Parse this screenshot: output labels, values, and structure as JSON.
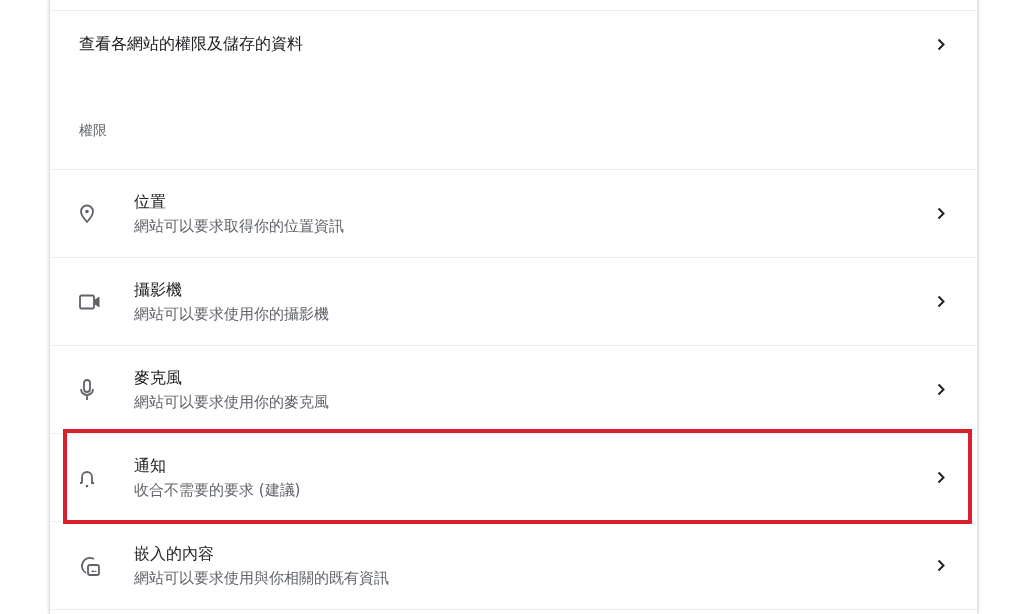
{
  "site_settings_link": {
    "label": "查看各網站的權限及儲存的資料"
  },
  "permissions": {
    "heading": "權限",
    "items": [
      {
        "kind": "location",
        "title": "位置",
        "subtitle": "網站可以要求取得你的位置資訊",
        "highlighted": false
      },
      {
        "kind": "camera",
        "title": "攝影機",
        "subtitle": "網站可以要求使用你的攝影機",
        "highlighted": false
      },
      {
        "kind": "microphone",
        "title": "麥克風",
        "subtitle": "網站可以要求使用你的麥克風",
        "highlighted": false
      },
      {
        "kind": "notifications",
        "title": "通知",
        "subtitle": "收合不需要的要求 (建議)",
        "highlighted": true
      },
      {
        "kind": "embedded",
        "title": "嵌入的內容",
        "subtitle": "網站可以要求使用與你相關的既有資訊",
        "highlighted": false
      }
    ]
  }
}
